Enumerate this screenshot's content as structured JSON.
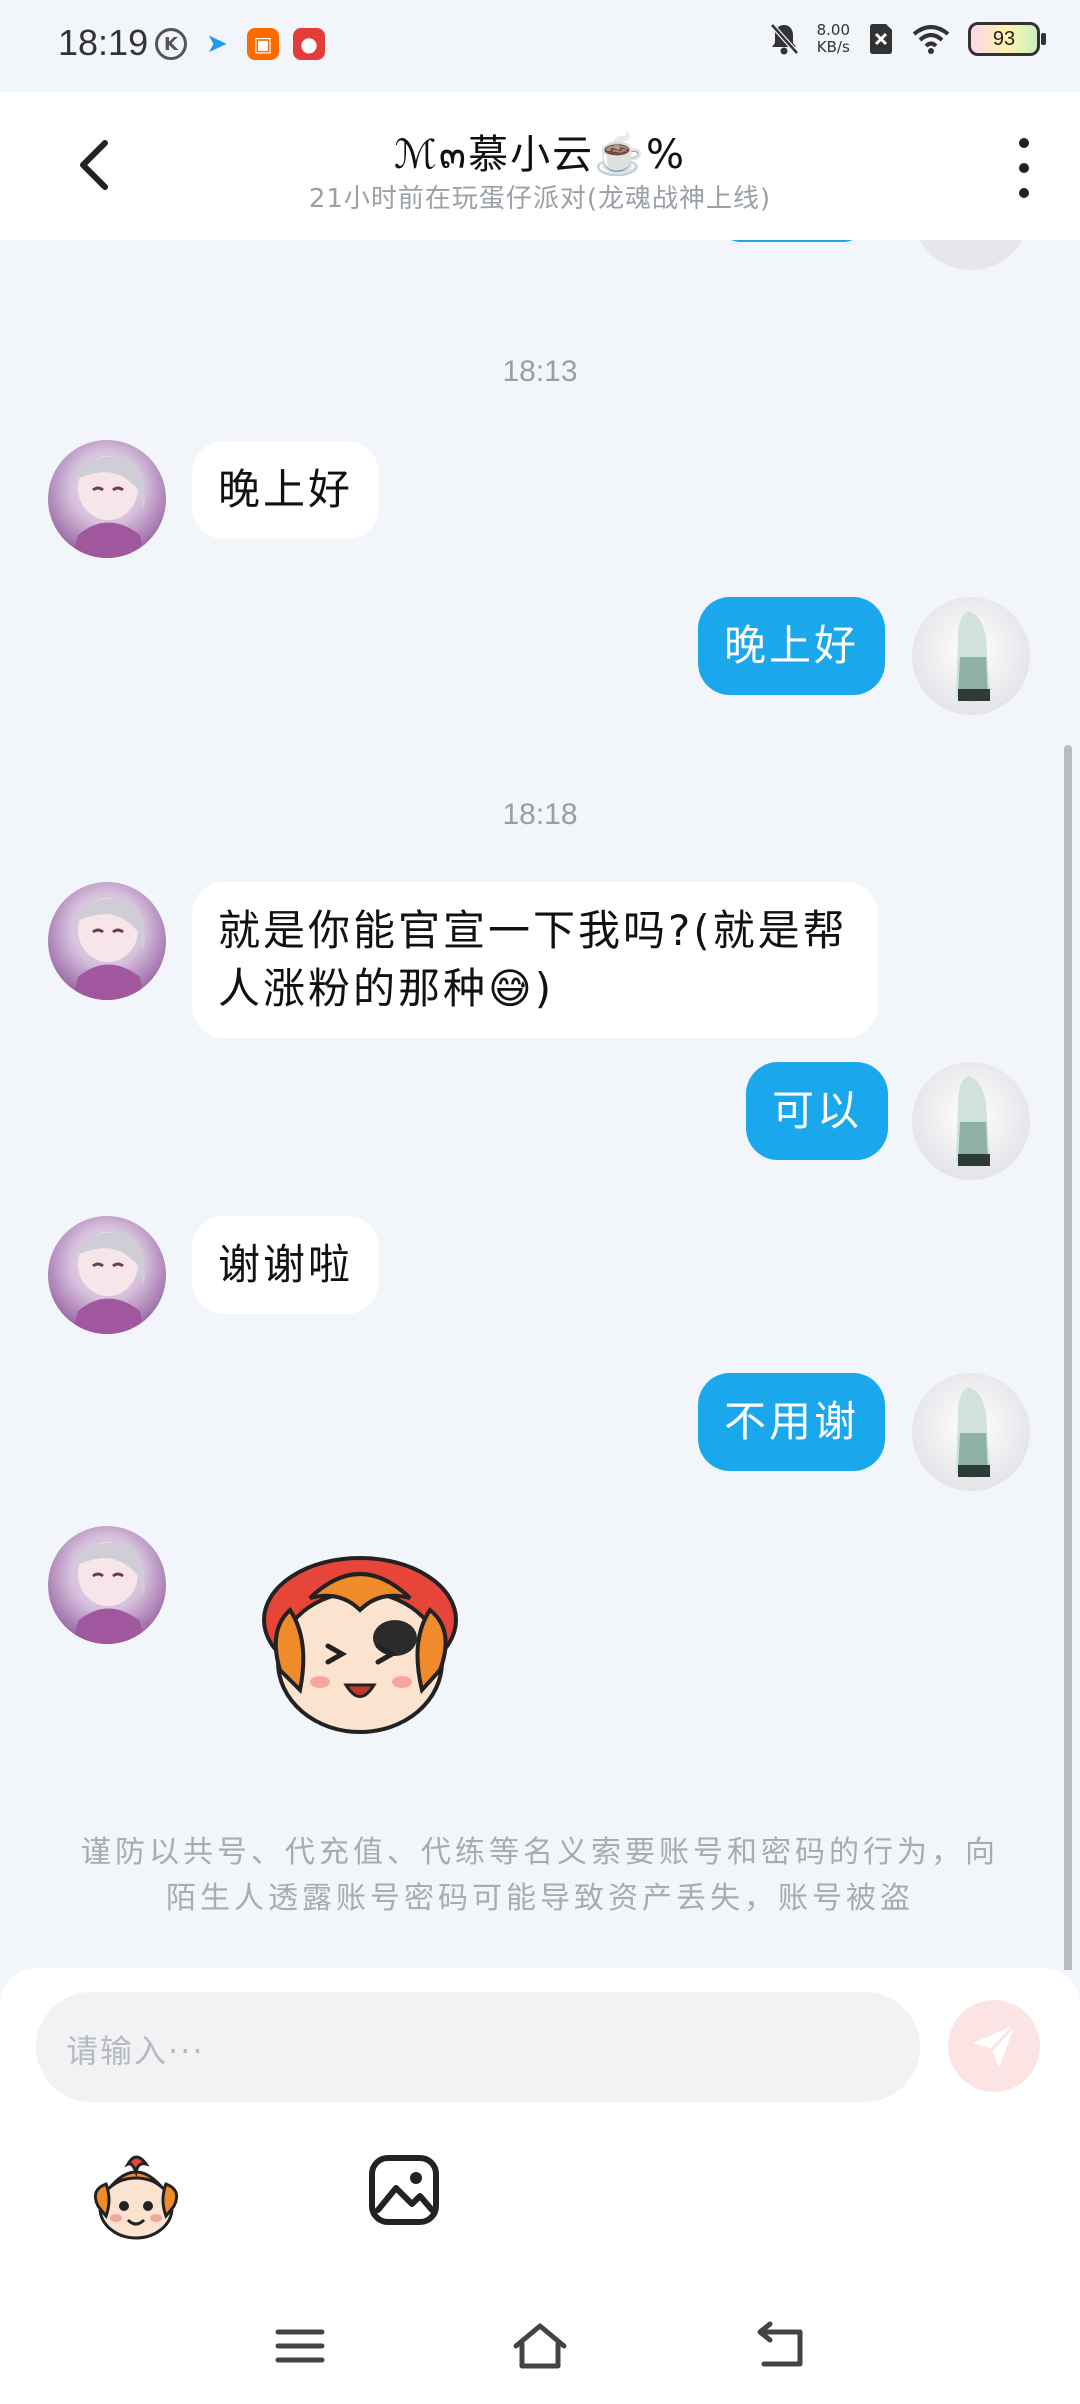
{
  "status_bar": {
    "time": "18:19",
    "net_speed_value": "8.00",
    "net_speed_unit": "KB/s",
    "battery": "93"
  },
  "header": {
    "title": "ℳ๓慕小云☕️%",
    "subtitle": "21小时前在玩蛋仔派对(龙魂战神上线)"
  },
  "messages": [
    {
      "type": "timestamp",
      "text": "18:13"
    },
    {
      "type": "in",
      "text": "晚上好"
    },
    {
      "type": "out",
      "text": "晚上好"
    },
    {
      "type": "timestamp",
      "text": "18:18"
    },
    {
      "type": "in",
      "text": "就是你能官宣一下我吗?(就是帮人涨粉的那种😅)"
    },
    {
      "type": "out",
      "text": "可以"
    },
    {
      "type": "in",
      "text": "谢谢啦"
    },
    {
      "type": "out",
      "text": "不用谢"
    },
    {
      "type": "in_sticker",
      "text": ""
    }
  ],
  "warning": "谨防以共号、代充值、代练等名义索要账号和密码的行为，向陌生人透露账号密码可能导致资产丢失，账号被盗",
  "input": {
    "placeholder": "请输入···"
  },
  "colors": {
    "accent": "#1aa7ec",
    "background": "#f2f5f9",
    "send_disabled": "#fde4e4"
  },
  "icons": {
    "back": "chevron-left-icon",
    "more": "more-vertical-icon",
    "send": "paper-plane-icon",
    "emoji": "eggy-emoji-icon",
    "image": "image-icon",
    "nav_menu": "menu-icon",
    "nav_home": "home-icon",
    "nav_back": "back-icon"
  }
}
